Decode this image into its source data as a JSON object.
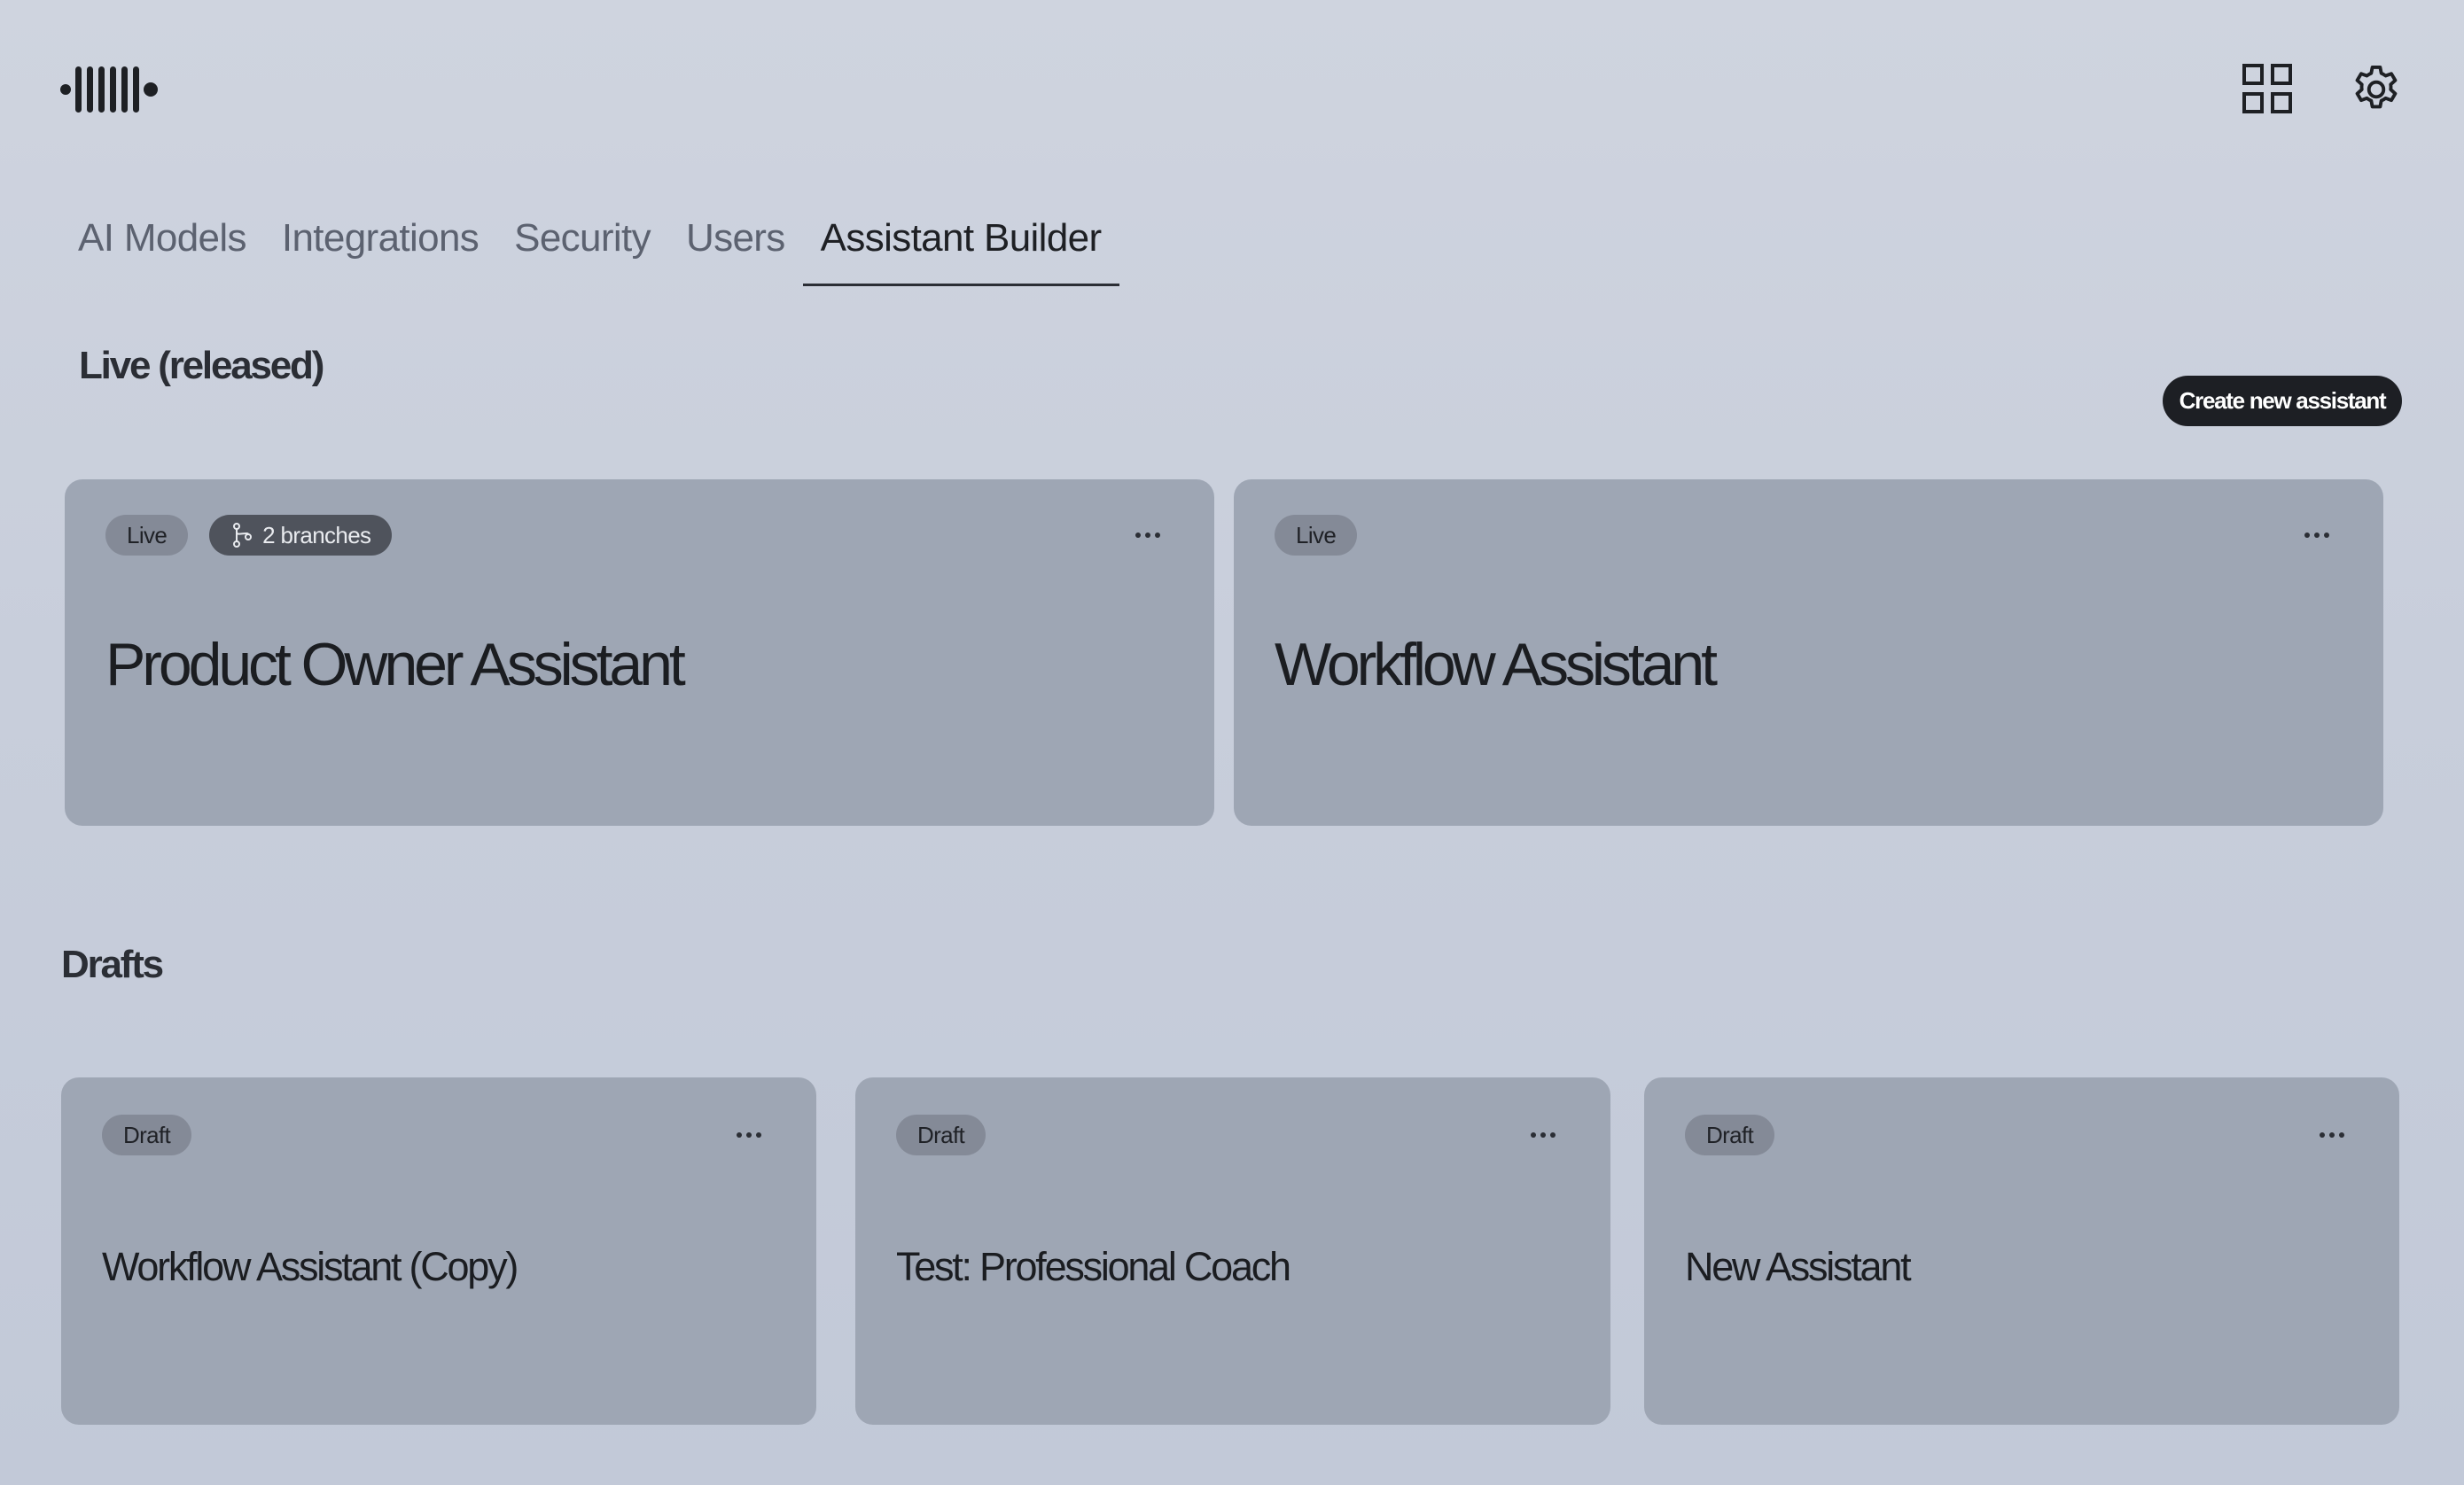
{
  "header": {
    "logo_icon": "audio-waveform-logo",
    "actions": [
      {
        "icon": "grid-icon"
      },
      {
        "icon": "gear-icon"
      }
    ]
  },
  "tabs": [
    {
      "label": "AI Models",
      "active": false
    },
    {
      "label": "Integrations",
      "active": false
    },
    {
      "label": "Security",
      "active": false
    },
    {
      "label": "Users",
      "active": false
    },
    {
      "label": "Assistant Builder",
      "active": true
    }
  ],
  "live_section": {
    "title": "Live (released)",
    "create_label": "Create new assistant",
    "cards": [
      {
        "status": "Live",
        "branches": "2 branches",
        "title": "Product Owner Assistant"
      },
      {
        "status": "Live",
        "title": "Workflow Assistant"
      }
    ]
  },
  "drafts_section": {
    "title": "Drafts",
    "cards": [
      {
        "status": "Draft",
        "title": "Workflow Assistant (Copy)"
      },
      {
        "status": "Draft",
        "title": "Test: Professional Coach"
      },
      {
        "status": "Draft",
        "title": "New Assistant"
      }
    ]
  },
  "colors": {
    "background": "#c8cedb",
    "card": "#9ea6b4",
    "primary_button": "#1d1f24",
    "badge_light": "#848a97",
    "badge_dark": "#4f535c"
  }
}
